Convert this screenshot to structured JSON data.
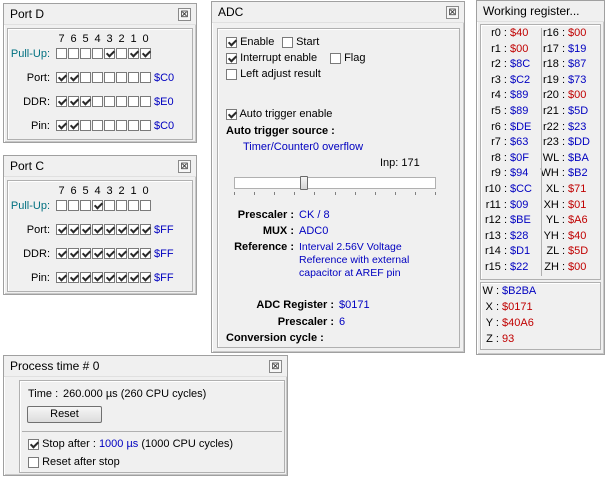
{
  "port_d": {
    "title": "Port D",
    "bit_numbers": [
      "7",
      "6",
      "5",
      "4",
      "3",
      "2",
      "1",
      "0"
    ],
    "pullup_label": "Pull-Up:",
    "pullup_bits": [
      0,
      0,
      0,
      0,
      1,
      0,
      1,
      1
    ],
    "port_label": "Port:",
    "port_bits": [
      1,
      1,
      0,
      0,
      0,
      0,
      0,
      0
    ],
    "port_value": "$C0",
    "ddr_label": "DDR:",
    "ddr_bits": [
      1,
      1,
      1,
      0,
      0,
      0,
      0,
      0
    ],
    "ddr_value": "$E0",
    "pin_label": "Pin:",
    "pin_bits": [
      1,
      1,
      0,
      0,
      0,
      0,
      0,
      0
    ],
    "pin_value": "$C0"
  },
  "port_c": {
    "title": "Port C",
    "bit_numbers": [
      "7",
      "6",
      "5",
      "4",
      "3",
      "2",
      "1",
      "0"
    ],
    "pullup_label": "Pull-Up:",
    "pullup_bits": [
      0,
      0,
      0,
      1,
      0,
      0,
      0,
      0
    ],
    "port_label": "Port:",
    "port_bits": [
      1,
      1,
      1,
      1,
      1,
      1,
      1,
      1
    ],
    "port_value": "$FF",
    "ddr_label": "DDR:",
    "ddr_bits": [
      1,
      1,
      1,
      1,
      1,
      1,
      1,
      1
    ],
    "ddr_value": "$FF",
    "pin_label": "Pin:",
    "pin_bits": [
      1,
      1,
      1,
      1,
      1,
      1,
      1,
      1
    ],
    "pin_value": "$FF"
  },
  "adc": {
    "title": "ADC",
    "enable_label": "Enable",
    "enable_checked": true,
    "start_label": "Start",
    "start_checked": false,
    "interrupt_label": "Interrupt enable",
    "interrupt_checked": true,
    "flag_label": "Flag",
    "flag_checked": false,
    "left_adjust_label": "Left adjust result",
    "left_adjust_checked": false,
    "auto_trigger_label": "Auto trigger enable",
    "auto_trigger_checked": true,
    "auto_trigger_source_label": "Auto trigger source :",
    "auto_trigger_source_value": "Timer/Counter0 overflow",
    "inp_label": "Inp: 171",
    "slider_fraction": 0.34,
    "prescaler_label": "Prescaler :",
    "prescaler_value": "CK / 8",
    "mux_label": "MUX :",
    "mux_value": "ADC0",
    "reference_label": "Reference :",
    "reference_lines": [
      "Interval 2.56V Voltage",
      "Reference with external",
      "capacitor at AREF pin"
    ],
    "adc_register_label": "ADC Register :",
    "adc_register_value": "$0171",
    "prescaler2_label": "Prescaler :",
    "prescaler2_value": "6",
    "conversion_label": "Conversion cycle :"
  },
  "registers": {
    "title": "Working register...",
    "left": [
      {
        "name": "r0 :",
        "value": "$40",
        "changed": true
      },
      {
        "name": "r1 :",
        "value": "$00",
        "changed": true
      },
      {
        "name": "r2 :",
        "value": "$8C",
        "changed": false
      },
      {
        "name": "r3 :",
        "value": "$C2",
        "changed": false
      },
      {
        "name": "r4 :",
        "value": "$89",
        "changed": false
      },
      {
        "name": "r5 :",
        "value": "$89",
        "changed": false
      },
      {
        "name": "r6 :",
        "value": "$DE",
        "changed": false
      },
      {
        "name": "r7 :",
        "value": "$63",
        "changed": false
      },
      {
        "name": "r8 :",
        "value": "$0F",
        "changed": false
      },
      {
        "name": "r9 :",
        "value": "$94",
        "changed": false
      },
      {
        "name": "r10 :",
        "value": "$CC",
        "changed": false
      },
      {
        "name": "r11 :",
        "value": "$09",
        "changed": false
      },
      {
        "name": "r12 :",
        "value": "$BE",
        "changed": false
      },
      {
        "name": "r13 :",
        "value": "$28",
        "changed": false
      },
      {
        "name": "r14 :",
        "value": "$D1",
        "changed": false
      },
      {
        "name": "r15 :",
        "value": "$22",
        "changed": false
      }
    ],
    "right": [
      {
        "name": "r16 :",
        "value": "$00",
        "changed": true
      },
      {
        "name": "r17 :",
        "value": "$19",
        "changed": false
      },
      {
        "name": "r18 :",
        "value": "$87",
        "changed": false
      },
      {
        "name": "r19 :",
        "value": "$73",
        "changed": false
      },
      {
        "name": "r20 :",
        "value": "$00",
        "changed": true
      },
      {
        "name": "r21 :",
        "value": "$5D",
        "changed": false
      },
      {
        "name": "r22 :",
        "value": "$23",
        "changed": false
      },
      {
        "name": "r23 :",
        "value": "$DD",
        "changed": false
      },
      {
        "name": "WL :",
        "value": "$BA",
        "changed": false
      },
      {
        "name": "WH :",
        "value": "$B2",
        "changed": false
      },
      {
        "name": "XL :",
        "value": "$71",
        "changed": true
      },
      {
        "name": "XH :",
        "value": "$01",
        "changed": true
      },
      {
        "name": "YL :",
        "value": "$A6",
        "changed": true
      },
      {
        "name": "YH :",
        "value": "$40",
        "changed": true
      },
      {
        "name": "ZL :",
        "value": "$5D",
        "changed": true
      },
      {
        "name": "ZH :",
        "value": "$00",
        "changed": true
      }
    ],
    "pairs": [
      {
        "name": "W :",
        "value": "$B2BA",
        "changed": false
      },
      {
        "name": "X :",
        "value": "$0171",
        "changed": true
      },
      {
        "name": "Y :",
        "value": "$40A6",
        "changed": true
      },
      {
        "name": "Z :",
        "value": "93",
        "changed": true
      }
    ]
  },
  "process_time": {
    "title": "Process time # 0",
    "time_label": "Time :",
    "time_value": "260.000 µs (260 CPU cycles)",
    "reset_button": "Reset",
    "stop_after_label": "Stop after :",
    "stop_after_checked": true,
    "stop_after_value": "1000 µs",
    "stop_after_cycles": "(1000 CPU cycles)",
    "reset_after_stop_label": "Reset after stop",
    "reset_after_stop_checked": false
  },
  "colors": {
    "value_blue": "#0000c0",
    "changed_red": "#c00000",
    "pullup_teal": "#007080"
  }
}
